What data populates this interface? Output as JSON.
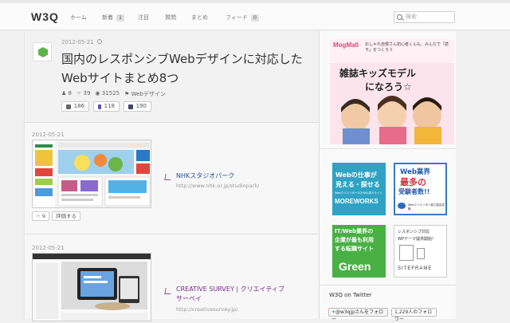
{
  "header": {
    "logo": "W3Q",
    "nav": [
      {
        "label": "ホーム",
        "badge": ""
      },
      {
        "label": "新着",
        "badge": "1"
      },
      {
        "label": "注目",
        "badge": ""
      },
      {
        "label": "質問",
        "badge": ""
      },
      {
        "label": "まとめ",
        "badge": ""
      },
      {
        "label": "フィード",
        "badge": "0"
      }
    ],
    "search_placeholder": "検索"
  },
  "article": {
    "date": "2012-05-21",
    "title": "国内のレスポンシブWebデザインに対応したWebサイトまとめ8つ",
    "meta": {
      "users": "8",
      "likes": "39",
      "views": "31525",
      "tag": "Webデザイン"
    },
    "share": {
      "hatena": "186",
      "twitter": "118",
      "facebook": "190"
    }
  },
  "entries": [
    {
      "date": "2012-05-21",
      "title": "NHKスタジオパーク",
      "url": "http://www.nhk.or.jp/studiopark/",
      "likes": "9",
      "rate_label": "評価する"
    },
    {
      "date": "2012-05-21",
      "title": "CREATIVE SURVEY | クリエイティブサーベイ",
      "url": "http://creativesurvey.jp/"
    }
  ],
  "sidebar": {
    "ads": {
      "mogmall": {
        "brand": "MogMall",
        "tagline": "おしゃれ自慢さん初心者くんも、みんなで「読モ」をつくろう",
        "headline1": "雑誌キッズモデル",
        "headline2": "になろう☆"
      },
      "moreworks": {
        "line1": "Webの仕事が",
        "line2": "見える・探せる",
        "small": "Webクリエイターのための求人サイト",
        "brand": "MOREWORKS"
      },
      "quiz": {
        "line1": "Web業界",
        "line2": "最多の",
        "line3": "受験者数!!",
        "small": "Webクリエイター能力認定試験"
      },
      "green": {
        "line1": "IT/Web業界の",
        "line2": "企業が最も利用",
        "line3": "する転職サイト",
        "brand": "Green"
      },
      "siteframe": {
        "line1": "レスポンシブ対応",
        "line2": "WPテーマ提供開始!",
        "brand": "SITEFRAME"
      }
    },
    "twitter": {
      "title": "W3Q on Twitter",
      "follow": "@w3qjpさんをフォロー",
      "followers": "1,229人のフォロワー"
    }
  }
}
